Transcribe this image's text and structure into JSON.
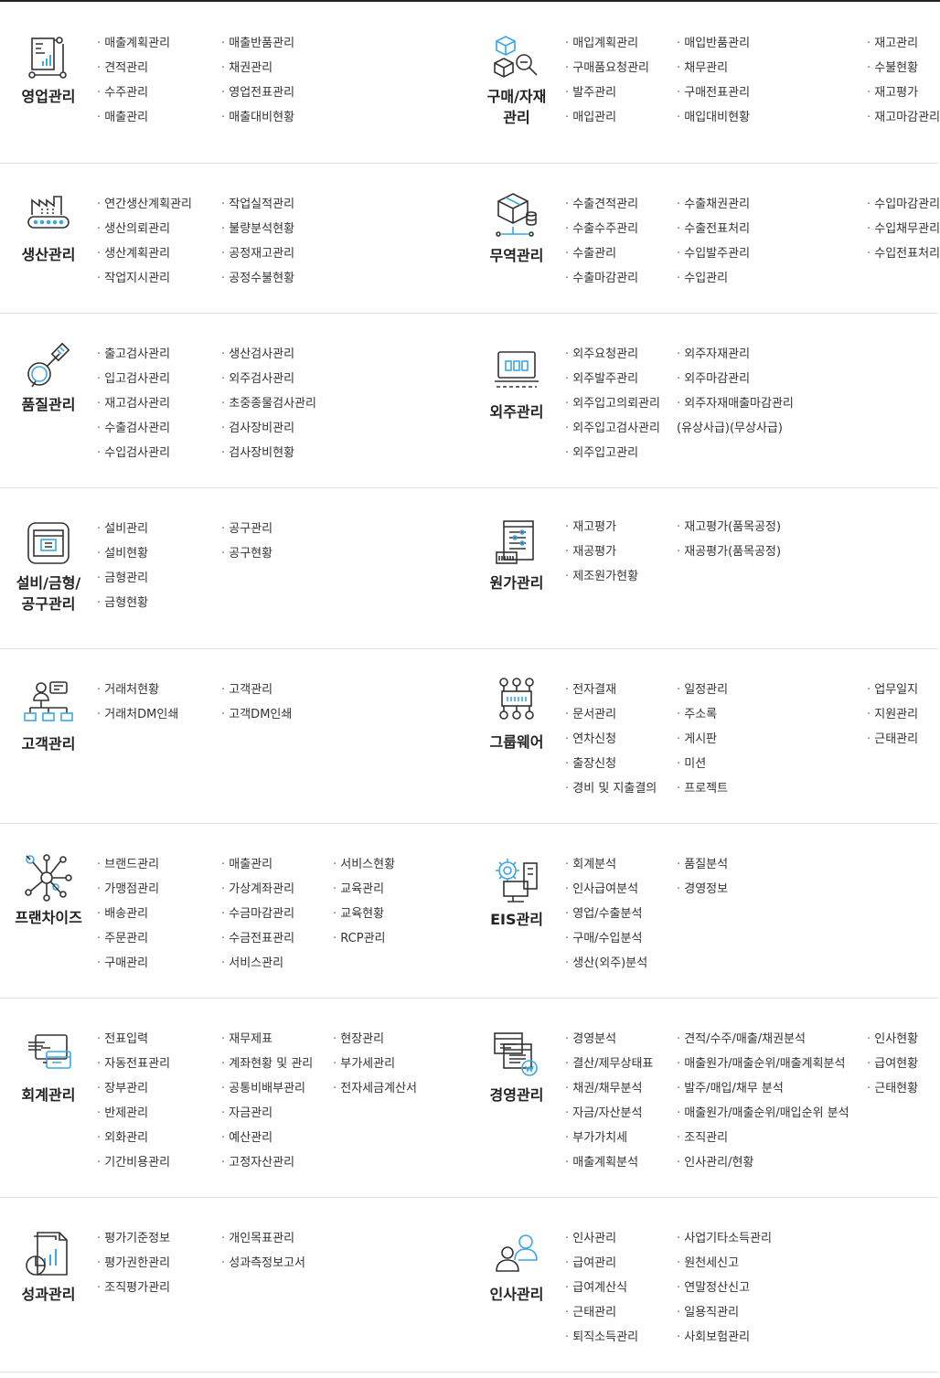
{
  "rows": [
    {
      "left": {
        "title": "영업관리",
        "icon": "sales-chart-icon",
        "cols": [
          [
            "매출계획관리",
            "견적관리",
            "수주관리",
            "매출관리"
          ],
          [
            "매출반품관리",
            "채권관리",
            "영업전표관리",
            "매출대비현황"
          ]
        ]
      },
      "right": {
        "title": "구매/자재\n관리",
        "icon": "cube-search-icon",
        "cols": [
          [
            "매입계획관리",
            "구매품요청관리",
            "발주관리",
            "매입관리"
          ],
          [
            "매입반품관리",
            "채무관리",
            "구매전표관리",
            "매입대비현황"
          ],
          [
            "재고관리",
            "수불현황",
            "재고평가",
            "재고마감관리"
          ]
        ]
      }
    },
    {
      "left": {
        "title": "생산관리",
        "icon": "factory-icon",
        "cols": [
          [
            "연간생산계획관리",
            "생산의뢰관리",
            "생산계획관리",
            "작업지시관리"
          ],
          [
            "작업실적관리",
            "불량분석현황",
            "공정재고관리",
            "공정수불현황"
          ]
        ]
      },
      "right": {
        "title": "무역관리",
        "icon": "shipping-box-icon",
        "cols": [
          [
            "수출견적관리",
            "수출수주관리",
            "수출관리",
            "수출마감관리"
          ],
          [
            "수출채권관리",
            "수출전표처리",
            "수입발주관리",
            "수입관리"
          ],
          [
            "수입마감관리",
            "수입채무관리",
            "수입전표처리"
          ]
        ]
      }
    },
    {
      "left": {
        "title": "품질관리",
        "icon": "quality-inspection-icon",
        "cols": [
          [
            "출고검사관리",
            "입고검사관리",
            "재고검사관리",
            "수출검사관리",
            "수입검사관리"
          ],
          [
            "생산검사관리",
            "외주검사관리",
            "초중종물검사관리",
            "검사장비관리",
            "검사장비현황"
          ]
        ]
      },
      "right": {
        "title": "외주관리",
        "icon": "laptop-icon",
        "cols": [
          [
            "외주요청관리",
            "외주발주관리",
            "외주입고의뢰관리",
            "외주입고검사관리",
            "외주입고관리"
          ],
          [
            "외주자재관리",
            "외주마감관리",
            "외주자재매출마감관리",
            "(유상사급)(무상사급)"
          ]
        ]
      }
    },
    {
      "left": {
        "title": "설비/금형/\n공구관리",
        "icon": "equipment-icon",
        "cols": [
          [
            "설비관리",
            "설비현황",
            "금형관리",
            "금형현황"
          ],
          [
            "공구관리",
            "공구현황"
          ]
        ]
      },
      "right": {
        "title": "원가관리",
        "icon": "cost-document-icon",
        "cols": [
          [
            "재고평가",
            "재공평가",
            "제조원가현황"
          ],
          [
            "재고평가(품목공정)",
            "재공평가(품목공정)"
          ]
        ]
      }
    },
    {
      "left": {
        "title": "고객관리",
        "icon": "customer-network-icon",
        "cols": [
          [
            "거래처현황",
            "거래처DM인쇄"
          ],
          [
            "고객관리",
            "고객DM인쇄"
          ]
        ]
      },
      "right": {
        "title": "그룹웨어",
        "icon": "groupware-icon",
        "cols": [
          [
            "전자결재",
            "문서관리",
            "연차신청",
            "출장신청",
            "경비 및 지출결의"
          ],
          [
            "일정관리",
            "주소록",
            "게시판",
            "미션",
            "프로젝트"
          ],
          [
            "업무일지",
            "지원관리",
            "근태관리"
          ]
        ]
      }
    },
    {
      "left": {
        "title": "프랜차이즈",
        "icon": "franchise-network-icon",
        "cols": [
          [
            "브랜드관리",
            "가맹점관리",
            "배송관리",
            "주문관리",
            "구매관리"
          ],
          [
            "매출관리",
            "가상계좌관리",
            "수금마감관리",
            "수금전표관리",
            "서비스관리"
          ],
          [
            "서비스현황",
            "교육관리",
            "교육현황",
            "RCP관리"
          ]
        ]
      },
      "right": {
        "title": "EIS관리",
        "icon": "eis-gear-icon",
        "cols": [
          [
            "회계분석",
            "인사급여분석",
            "영업/수출분석",
            "구매/수입분석",
            "생산(외주)분석"
          ],
          [
            "품질분석",
            "경영정보"
          ]
        ]
      }
    },
    {
      "left": {
        "title": "회계관리",
        "icon": "accounting-card-icon",
        "cols": [
          [
            "전표입력",
            "자동전표관리",
            "장부관리",
            "반제관리",
            "외화관리",
            "기간비용관리"
          ],
          [
            "재무제표",
            "계좌현황 및 관리",
            "공통비배부관리",
            "자금관리",
            "예산관리",
            "고정자산관리"
          ],
          [
            "현장관리",
            "부가세관리",
            "전자세금계산서"
          ]
        ]
      },
      "right": {
        "title": "경영관리",
        "icon": "management-won-icon",
        "cols": [
          [
            "경영분석",
            "결산/제무상태표",
            "채권/채무분석",
            "자금/자산분석",
            "부가가치세",
            "매출계획분석"
          ],
          [
            "견적/수주/매출/채권분석",
            "매출원가/매출순위/매출계획분석",
            "발주/매입/채무 분석",
            "매출원가/매출순위/매입순위 분석",
            "조직관리",
            "인사관리/현황"
          ],
          [
            "인사현황",
            "급여현황",
            "근태현황"
          ]
        ]
      }
    },
    {
      "left": {
        "title": "성과관리",
        "icon": "performance-report-icon",
        "cols": [
          [
            "평가기준정보",
            "평가권한관리",
            "조직평가관리"
          ],
          [
            "개인목표관리",
            "성과측정보고서"
          ]
        ]
      },
      "right": {
        "title": "인사관리",
        "icon": "personnel-icon",
        "cols": [
          [
            "인사관리",
            "급여관리",
            "급여계산식",
            "근태관리",
            "퇴직소득관리"
          ],
          [
            "사업기타소득관리",
            "원천세신고",
            "연말정산신고",
            "일용직관리",
            "사회보험관리"
          ]
        ]
      }
    }
  ]
}
